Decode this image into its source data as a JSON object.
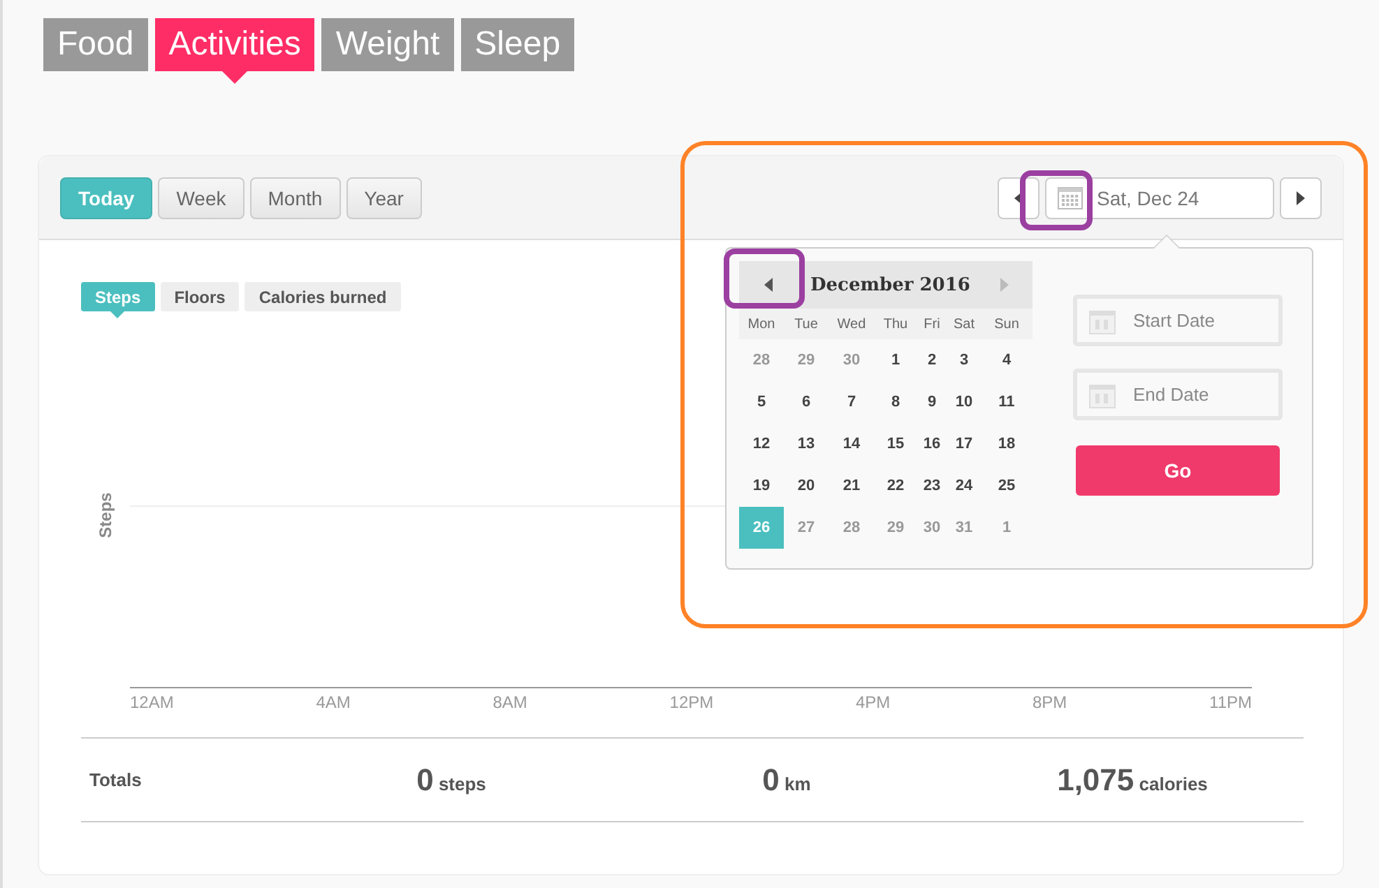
{
  "main_tabs": [
    {
      "label": "Food",
      "selected": false
    },
    {
      "label": "Activities",
      "selected": true
    },
    {
      "label": "Weight",
      "selected": false
    },
    {
      "label": "Sleep",
      "selected": false
    }
  ],
  "period_buttons": [
    {
      "label": "Today",
      "selected": true
    },
    {
      "label": "Week",
      "selected": false
    },
    {
      "label": "Month",
      "selected": false
    },
    {
      "label": "Year",
      "selected": false
    }
  ],
  "date_nav": {
    "value": "Sat, Dec 24",
    "highlighted": true,
    "icon_highlighted": true
  },
  "date_popup": {
    "calendar": {
      "month": "December 2016",
      "prev_highlighted": true,
      "weekdays": [
        "Mon",
        "Tue",
        "Wed",
        "Thu",
        "Fri",
        "Sat",
        "Sun"
      ],
      "weeks": [
        [
          {
            "day": "28",
            "muted": true,
            "selected": false
          },
          {
            "day": "29",
            "muted": true,
            "selected": false
          },
          {
            "day": "30",
            "muted": true,
            "selected": false
          },
          {
            "day": "1",
            "muted": false,
            "selected": false
          },
          {
            "day": "2",
            "muted": false,
            "selected": false
          },
          {
            "day": "3",
            "muted": false,
            "selected": false
          },
          {
            "day": "4",
            "muted": false,
            "selected": false
          }
        ],
        [
          {
            "day": "5",
            "muted": false,
            "selected": false
          },
          {
            "day": "6",
            "muted": false,
            "selected": false
          },
          {
            "day": "7",
            "muted": false,
            "selected": false
          },
          {
            "day": "8",
            "muted": false,
            "selected": false
          },
          {
            "day": "9",
            "muted": false,
            "selected": false
          },
          {
            "day": "10",
            "muted": false,
            "selected": false
          },
          {
            "day": "11",
            "muted": false,
            "selected": false
          }
        ],
        [
          {
            "day": "12",
            "muted": false,
            "selected": false
          },
          {
            "day": "13",
            "muted": false,
            "selected": false
          },
          {
            "day": "14",
            "muted": false,
            "selected": false
          },
          {
            "day": "15",
            "muted": false,
            "selected": false
          },
          {
            "day": "16",
            "muted": false,
            "selected": false
          },
          {
            "day": "17",
            "muted": false,
            "selected": false
          },
          {
            "day": "18",
            "muted": false,
            "selected": false
          }
        ],
        [
          {
            "day": "19",
            "muted": false,
            "selected": false
          },
          {
            "day": "20",
            "muted": false,
            "selected": false
          },
          {
            "day": "21",
            "muted": false,
            "selected": false
          },
          {
            "day": "22",
            "muted": false,
            "selected": false
          },
          {
            "day": "23",
            "muted": false,
            "selected": false
          },
          {
            "day": "24",
            "muted": false,
            "selected": false
          },
          {
            "day": "25",
            "muted": false,
            "selected": false
          }
        ],
        [
          {
            "day": "26",
            "muted": false,
            "selected": true
          },
          {
            "day": "27",
            "muted": true,
            "selected": false
          },
          {
            "day": "28",
            "muted": true,
            "selected": false
          },
          {
            "day": "29",
            "muted": true,
            "selected": false
          },
          {
            "day": "30",
            "muted": true,
            "selected": false
          },
          {
            "day": "31",
            "muted": true,
            "selected": false
          },
          {
            "day": "1",
            "muted": true,
            "selected": false
          }
        ]
      ]
    },
    "start_date": {
      "placeholder": "Start Date"
    },
    "end_date": {
      "placeholder": "End Date"
    },
    "go_button": "Go"
  },
  "metric_tabs": [
    {
      "label": "Steps",
      "selected": true
    },
    {
      "label": "Floors",
      "selected": false
    },
    {
      "label": "Calories burned",
      "selected": false
    }
  ],
  "chart": {
    "y_label": "Steps",
    "x_labels": [
      "12AM",
      "4AM",
      "8AM",
      "12PM",
      "4PM",
      "8PM",
      "11PM"
    ]
  },
  "totals": {
    "label": "Totals",
    "items": [
      {
        "value": "0",
        "unit": "steps"
      },
      {
        "value": "0",
        "unit": "km"
      },
      {
        "value": "1,075",
        "unit": "calories"
      }
    ]
  }
}
